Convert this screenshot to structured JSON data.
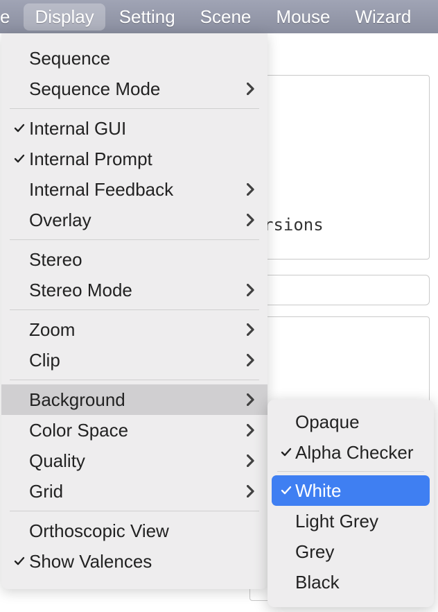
{
  "menubar": {
    "truncated0": "e",
    "items": [
      "Display",
      "Setting",
      "Scene",
      "Mouse",
      "Wizard"
    ],
    "active_index": 0
  },
  "display_menu": {
    "groups": [
      [
        {
          "label": "Sequence",
          "checked": false,
          "submenu": false
        },
        {
          "label": "Sequence Mode",
          "checked": false,
          "submenu": true
        }
      ],
      [
        {
          "label": "Internal GUI",
          "checked": true,
          "submenu": false
        },
        {
          "label": "Internal Prompt",
          "checked": true,
          "submenu": false
        },
        {
          "label": "Internal Feedback",
          "checked": false,
          "submenu": true
        },
        {
          "label": "Overlay",
          "checked": false,
          "submenu": true
        }
      ],
      [
        {
          "label": "Stereo",
          "checked": false,
          "submenu": false
        },
        {
          "label": "Stereo Mode",
          "checked": false,
          "submenu": true
        }
      ],
      [
        {
          "label": "Zoom",
          "checked": false,
          "submenu": true
        },
        {
          "label": "Clip",
          "checked": false,
          "submenu": true
        }
      ],
      [
        {
          "label": "Background",
          "checked": false,
          "submenu": true,
          "hovered": true
        },
        {
          "label": "Color Space",
          "checked": false,
          "submenu": true
        },
        {
          "label": "Quality",
          "checked": false,
          "submenu": true
        },
        {
          "label": "Grid",
          "checked": false,
          "submenu": true
        }
      ],
      [
        {
          "label": "Orthoscopic View",
          "checked": false,
          "submenu": false
        },
        {
          "label": "Show Valences",
          "checked": true,
          "submenu": false
        }
      ]
    ]
  },
  "background_submenu": {
    "groups": [
      [
        {
          "label": "Opaque",
          "checked": false,
          "selected": false
        },
        {
          "label": "Alpha Checker",
          "checked": true,
          "selected": false
        }
      ],
      [
        {
          "label": "White",
          "checked": true,
          "selected": true
        },
        {
          "label": "Light Grey",
          "checked": false,
          "selected": false
        },
        {
          "label": "Grey",
          "checked": false,
          "selected": false
        },
        {
          "label": "Black",
          "checked": false,
          "selected": false
        }
      ]
    ]
  },
  "background_text": "rsions"
}
